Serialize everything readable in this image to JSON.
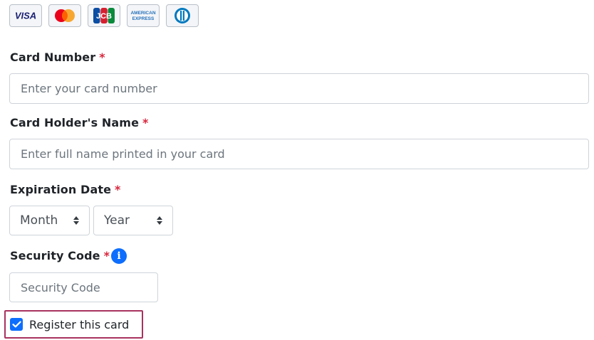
{
  "card_brands": [
    {
      "name": "VISA",
      "icon": "visa-logo-icon"
    },
    {
      "name": "Mastercard",
      "icon": "mastercard-logo-icon"
    },
    {
      "name": "JCB",
      "icon": "jcb-logo-icon"
    },
    {
      "name": "AMERICAN EXPRESS",
      "icon": "amex-logo-icon"
    },
    {
      "name": "Diners Club",
      "icon": "diners-logo-icon"
    }
  ],
  "card_number": {
    "label": "Card Number",
    "required_mark": "*",
    "placeholder": "Enter your card number",
    "value": ""
  },
  "holder_name": {
    "label": "Card Holder's Name",
    "required_mark": "*",
    "placeholder": "Enter full name printed in your card",
    "value": ""
  },
  "expiration": {
    "label": "Expiration Date",
    "required_mark": "*",
    "month": "Month",
    "year": "Year"
  },
  "security_code": {
    "label": "Security Code",
    "required_mark": "*",
    "placeholder": "Security Code",
    "value": "",
    "info_icon": "i"
  },
  "register": {
    "label": "Register this card",
    "checked": true
  },
  "colors": {
    "required": "#d7263d",
    "accent": "#0d6efd",
    "highlight_border": "#a8325e"
  }
}
